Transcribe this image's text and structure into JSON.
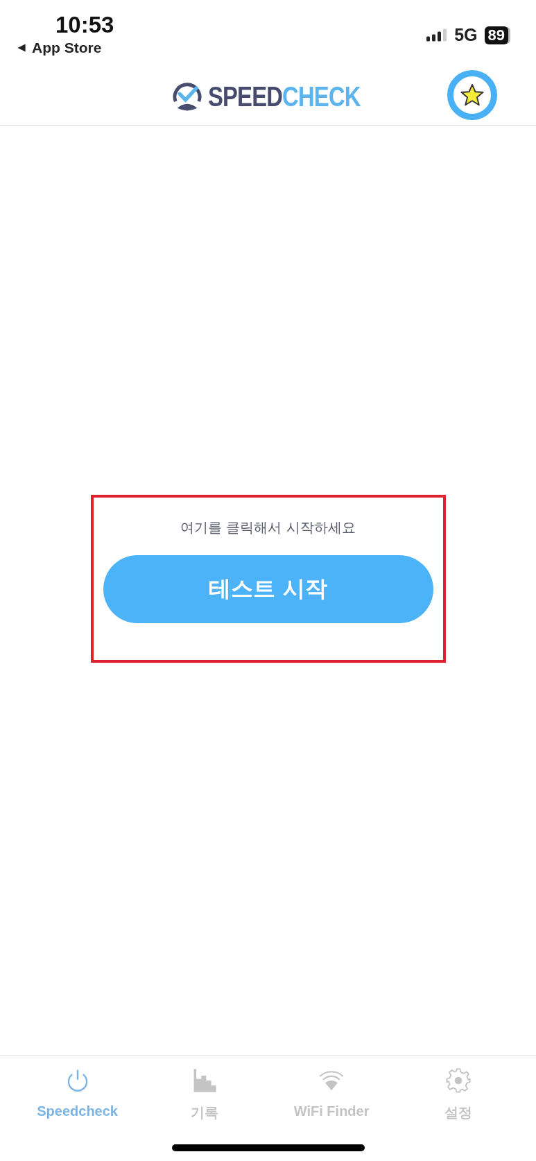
{
  "status_bar": {
    "time": "10:53",
    "back_label": "App Store",
    "network": "5G",
    "battery": "89"
  },
  "header": {
    "logo": {
      "first": "SPEED",
      "second": "CHECK"
    }
  },
  "start": {
    "hint": "여기를 클릭해서 시작하세요",
    "button": "테스트 시작",
    "highlight_frame": true
  },
  "tabs": [
    {
      "label": "Speedcheck",
      "kind": "power",
      "selected": true
    },
    {
      "label": "기록",
      "kind": "history",
      "selected": false
    },
    {
      "label": "WiFi Finder",
      "kind": "wifi",
      "selected": false
    },
    {
      "label": "설정",
      "kind": "settings",
      "selected": false
    }
  ]
}
